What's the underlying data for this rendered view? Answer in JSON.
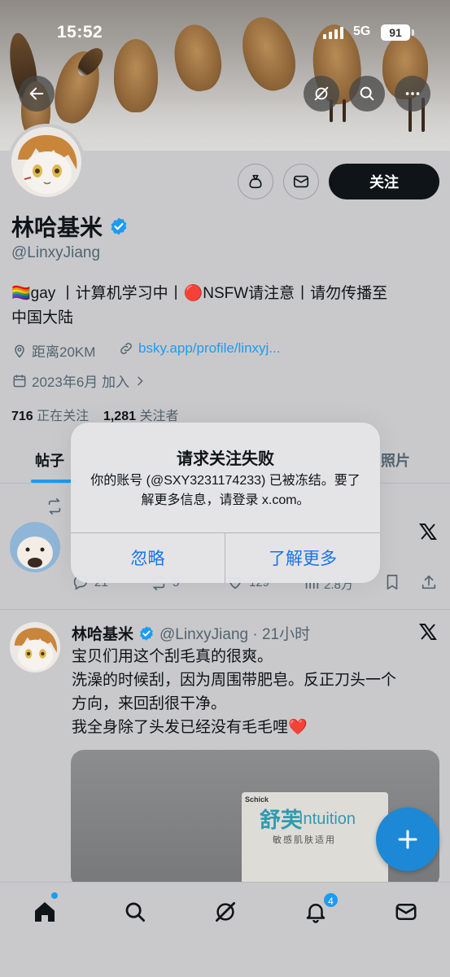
{
  "status_bar": {
    "time": "15:52",
    "network": "5G",
    "battery": "91"
  },
  "profile": {
    "name": "林哈基米",
    "handle": "@LinxyJiang",
    "bio_line1": "🏳️‍🌈gay 丨计算机学习中丨🔴NSFW请注意丨请勿传播至",
    "bio_line2": "中国大陆",
    "location": "距离20KM",
    "website": "bsky.app/profile/linxyj...",
    "joined": "2023年6月 加入",
    "following_count": "716",
    "following_label": "正在关注",
    "followers_count": "1,281",
    "followers_label": "关注者",
    "follow_button": "关注"
  },
  "tabs": {
    "posts": "帖子",
    "photos": "照片"
  },
  "tweet1": {
    "replies": "21",
    "reposts": "5",
    "likes": "129",
    "views": "2.8万"
  },
  "tweet2": {
    "name": "林哈基米",
    "handle_time": "@LinxyJiang · 21小时",
    "line1": "宝贝们用这个刮毛真的很爽。",
    "line2": "洗澡的时候刮，因为周围带肥皂。反正刀头一个",
    "line3": "方向，来回刮很干净。",
    "line4": "我全身除了头发已经没有毛毛哩❤️",
    "image_text": {
      "schick": "Schick",
      "brand_cn": "舒芙",
      "brand_en": "Intuition",
      "sub": "敏感肌肤适用"
    }
  },
  "alert": {
    "title": "请求关注失败",
    "message": "你的账号 (@SXY3231174233) 已被冻结。要了解更多信息，请登录 x.com。",
    "ignore_button": "忽略",
    "learn_more_button": "了解更多"
  },
  "nav": {
    "notifications_badge": "4"
  },
  "colors": {
    "accent": "#1d9bf0",
    "alert_button": "#1a73e8",
    "verified": "#1d9bf0"
  }
}
